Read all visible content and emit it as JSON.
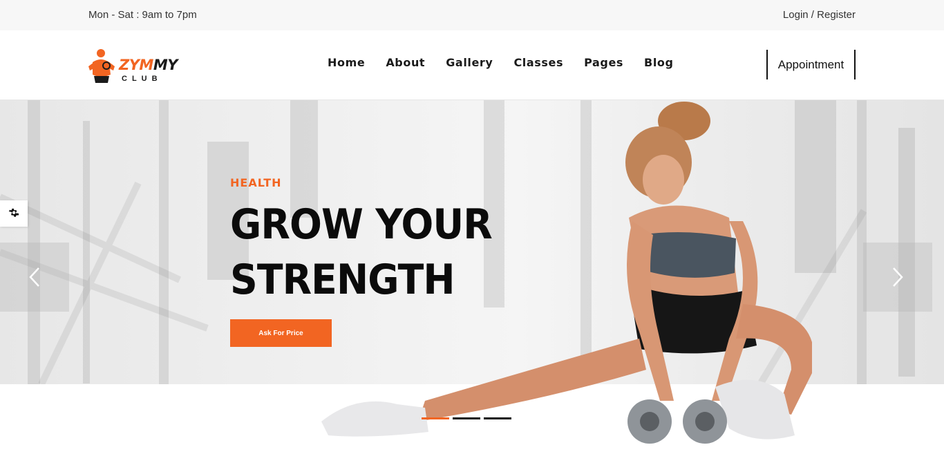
{
  "topbar": {
    "hours": "Mon - Sat : 9am to 7pm",
    "login": "Login",
    "separator": "/",
    "register": "Register"
  },
  "logo": {
    "word_a": "ZYM",
    "word_b": "MY",
    "sub": "CLUB"
  },
  "nav": {
    "items": [
      "Home",
      "About",
      "Gallery",
      "Classes",
      "Pages",
      "Blog"
    ]
  },
  "header": {
    "appointment": "Appointment"
  },
  "hero": {
    "kicker": "HEALTH",
    "headline_line1": "GROW YOUR",
    "headline_line2": "STRENGTH",
    "cta": "Ask For Price"
  },
  "slider": {
    "prev_icon": "chevron-left-icon",
    "next_icon": "chevron-right-icon",
    "active_index": 0,
    "dot_count": 3
  },
  "settings_icon": "gear-icon",
  "colors": {
    "accent": "#f26522",
    "text": "#111111",
    "topbar_bg": "#f7f7f7"
  }
}
